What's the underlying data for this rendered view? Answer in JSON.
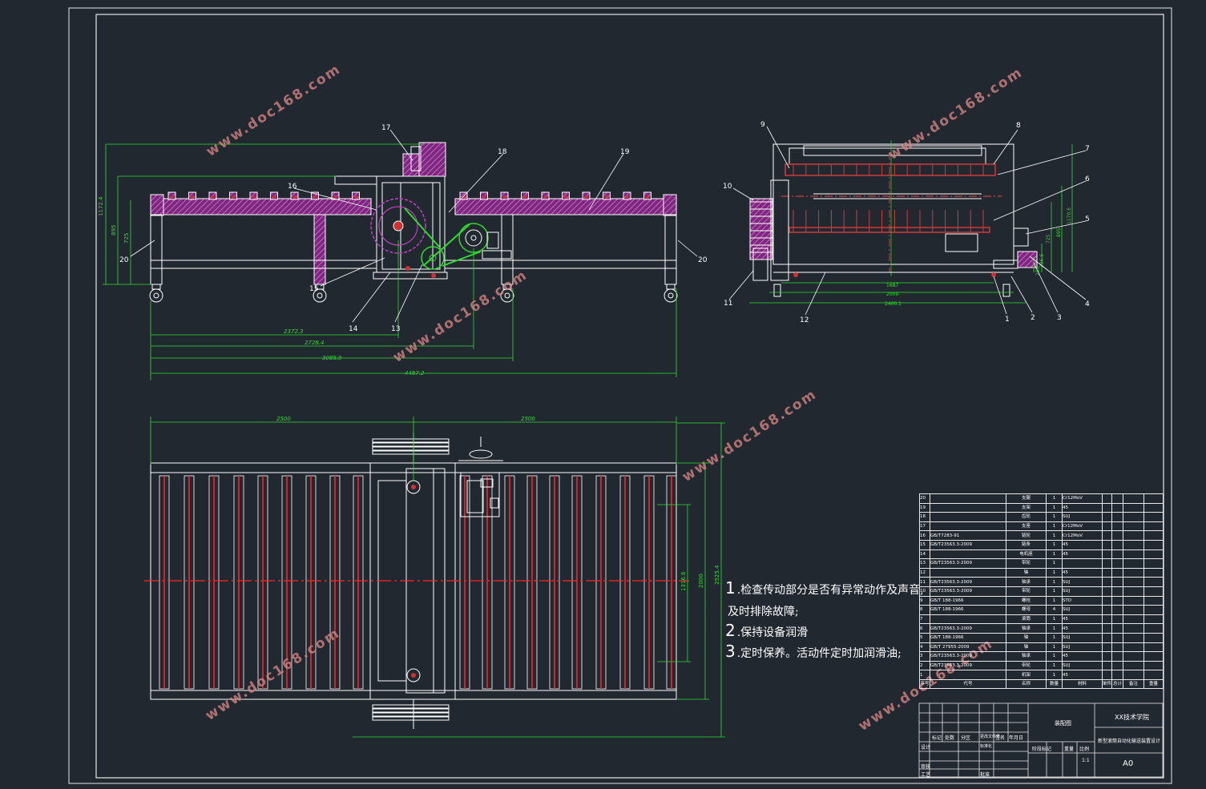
{
  "watermark": "www.doc168.com",
  "top_front_view": {
    "balloons": [
      "17",
      "18",
      "19",
      "16",
      "15",
      "14",
      "13",
      "20",
      "20"
    ],
    "dims": {
      "h1": "1172.4",
      "h2": "895",
      "h3": "725",
      "d1": "2372.3",
      "d2": "2728.4",
      "d3": "3085.9",
      "d4": "4487.2"
    }
  },
  "side_view": {
    "balloons": [
      "9",
      "8",
      "7",
      "6",
      "5",
      "4",
      "3",
      "2",
      "1",
      "10",
      "11",
      "12"
    ],
    "dims": {
      "w1": "1687",
      "w2": "2000",
      "w3": "2400.1",
      "h1": "1170.6",
      "h2": "895",
      "h3": "725",
      "h4": "286.6",
      "h5": "250"
    }
  },
  "plan_view": {
    "dims": {
      "top_left": "2500",
      "top_right": "2500",
      "v1": "2525.4",
      "v2": "2000",
      "v3": "1316.6"
    }
  },
  "notes": [
    {
      "num": "1",
      "text": ".检查传动部分是否有异常动作及声音,"
    },
    {
      "num": "",
      "text": "及时排除故障;"
    },
    {
      "num": "2",
      "text": ".保持设备润滑"
    },
    {
      "num": "3",
      "text": ".定时保养。活动件定时加润滑油;"
    }
  ],
  "bom": {
    "rows": [
      {
        "no": "20",
        "std": "",
        "name": "支腿",
        "qty": "1",
        "mat": "Cr12MoV"
      },
      {
        "no": "19",
        "std": "",
        "name": "支架",
        "qty": "1",
        "mat": "45"
      },
      {
        "no": "18",
        "std": "",
        "name": "齿轮",
        "qty": "1",
        "mat": "SUJ"
      },
      {
        "no": "17",
        "std": "",
        "name": "支座",
        "qty": "1",
        "mat": "Cr12MoV"
      },
      {
        "no": "16",
        "std": "GB/T7283-91",
        "name": "链轮",
        "qty": "1",
        "mat": "Cr12MoV"
      },
      {
        "no": "15",
        "std": "GB/T23563.3-2009",
        "name": "链条",
        "qty": "1",
        "mat": "45"
      },
      {
        "no": "14",
        "std": "",
        "name": "电机座",
        "qty": "1",
        "mat": "45"
      },
      {
        "no": "13",
        "std": "GB/T23563.3-2009",
        "name": "带轮",
        "qty": "1",
        "mat": ""
      },
      {
        "no": "12",
        "std": "",
        "name": "轴",
        "qty": "1",
        "mat": "45"
      },
      {
        "no": "11",
        "std": "GB/T23563.3-2009",
        "name": "轴承",
        "qty": "1",
        "mat": "SUJ"
      },
      {
        "no": "10",
        "std": "GB/T23563.3-2009",
        "name": "带轮",
        "qty": "1",
        "mat": "SUJ"
      },
      {
        "no": "9",
        "std": "GB/T 188-1966",
        "name": "螺栓",
        "qty": "1",
        "mat": "STD"
      },
      {
        "no": "8",
        "std": "GB/T 188-1966",
        "name": "螺母",
        "qty": "4",
        "mat": "SUJ"
      },
      {
        "no": "7",
        "std": "",
        "name": "滚筒",
        "qty": "1",
        "mat": "45"
      },
      {
        "no": "6",
        "std": "GB/T23563.3-2009",
        "name": "轴承",
        "qty": "1",
        "mat": "45"
      },
      {
        "no": "5",
        "std": "GB/T 188-1966",
        "name": "轴",
        "qty": "1",
        "mat": "SUJ"
      },
      {
        "no": "4",
        "std": "GB/T 27955-2009",
        "name": "轴",
        "qty": "1",
        "mat": "SUJ"
      },
      {
        "no": "3",
        "std": "GB/T23563.3-2009",
        "name": "轴承",
        "qty": "1",
        "mat": "45"
      },
      {
        "no": "2",
        "std": "GB/T23563.3-2009",
        "name": "带轮",
        "qty": "1",
        "mat": "SUJ"
      },
      {
        "no": "1",
        "std": "",
        "name": "机架",
        "qty": "1",
        "mat": "45"
      }
    ],
    "header": {
      "no": "序号",
      "std": "代号",
      "name": "名称",
      "qty": "数量",
      "mat": "材料",
      "c1": "单件",
      "c2": "总计",
      "c3": "备注",
      "c4": "重量"
    }
  },
  "title_block": {
    "school": "XX技术学院",
    "drawing_title": "装配图",
    "project": "新型滚筒自动化输送装置设计",
    "sheet": "A0",
    "labels": {
      "mark": "标记",
      "count": "处数",
      "zone": "分区",
      "change": "更改文件号",
      "sign": "签名",
      "date": "年月日",
      "design": "设计",
      "std": "标准化",
      "check": "审核",
      "process": "工艺",
      "approve": "批准",
      "stage": "阶段标记",
      "weight": "重量",
      "scale": "比例",
      "ratio": "1:1"
    }
  },
  "colors": {
    "background": "#212830",
    "frame": "#e8e8e8",
    "section": "#b83ab8",
    "dim": "#2edb2e",
    "red": "#ff2424",
    "white": "#ffffff"
  }
}
